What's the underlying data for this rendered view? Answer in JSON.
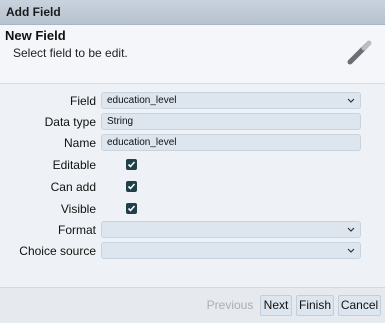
{
  "window": {
    "title": "Add Field"
  },
  "header": {
    "title": "New Field",
    "subtitle": "Select field to be edit.",
    "icon": "magic-wand-icon"
  },
  "form": {
    "field": {
      "label": "Field",
      "value": "education_level"
    },
    "data_type": {
      "label": "Data type",
      "value": "String"
    },
    "name": {
      "label": "Name",
      "value": "education_level"
    },
    "editable": {
      "label": "Editable",
      "checked": true
    },
    "can_add": {
      "label": "Can add",
      "checked": true
    },
    "visible": {
      "label": "Visible",
      "checked": true
    },
    "format": {
      "label": "Format",
      "value": ""
    },
    "choice_source": {
      "label": "Choice source",
      "value": ""
    }
  },
  "footer": {
    "previous": "Previous",
    "next": "Next",
    "finish": "Finish",
    "cancel": "Cancel"
  }
}
